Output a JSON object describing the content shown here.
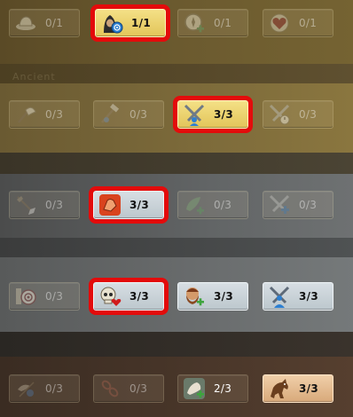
{
  "rows": [
    {
      "tiles": [
        {
          "icon": "hat-icon",
          "count": "0/1"
        },
        {
          "icon": "hooded-rogue-target-icon",
          "count": "1/1"
        },
        {
          "icon": "compass-plus-icon",
          "count": "0/1"
        },
        {
          "icon": "heart-shield-icon",
          "count": "0/1"
        }
      ]
    },
    {
      "tiles": [
        {
          "icon": "axe-icon",
          "count": "0/3"
        },
        {
          "icon": "tools-icon",
          "count": "0/3"
        },
        {
          "icon": "crossed-swords-group-icon",
          "count": "3/3"
        },
        {
          "icon": "crossed-swords-clock-icon",
          "count": "0/3"
        }
      ]
    },
    {
      "tiles": [
        {
          "icon": "spear-icon",
          "count": "0/3"
        },
        {
          "icon": "fist-icon",
          "count": "3/3"
        },
        {
          "icon": "leaf-plus-icon",
          "count": "0/3"
        },
        {
          "icon": "crossed-swords-plus-icon",
          "count": "0/3"
        }
      ]
    },
    {
      "tiles": [
        {
          "icon": "target-icon",
          "count": "0/3"
        },
        {
          "icon": "skull-heart-icon",
          "count": "3/3"
        },
        {
          "icon": "bearded-face-plus-icon",
          "count": "3/3"
        },
        {
          "icon": "crossed-swords-person-icon",
          "count": "3/3"
        }
      ]
    },
    {
      "tiles": [
        {
          "icon": "bird-arrow-icon",
          "count": "0/3"
        },
        {
          "icon": "chain-icon",
          "count": "0/3"
        },
        {
          "icon": "hand-boost-icon",
          "count": "2/3"
        },
        {
          "icon": "horse-icon",
          "count": "3/3"
        }
      ]
    }
  ],
  "ghost_text": "Ancient",
  "colors": {
    "highlight_border": "#e30b0b",
    "active_gold": "#e2c55a",
    "active_silver": "#bcc7cd",
    "active_copper": "#d8a97a"
  }
}
